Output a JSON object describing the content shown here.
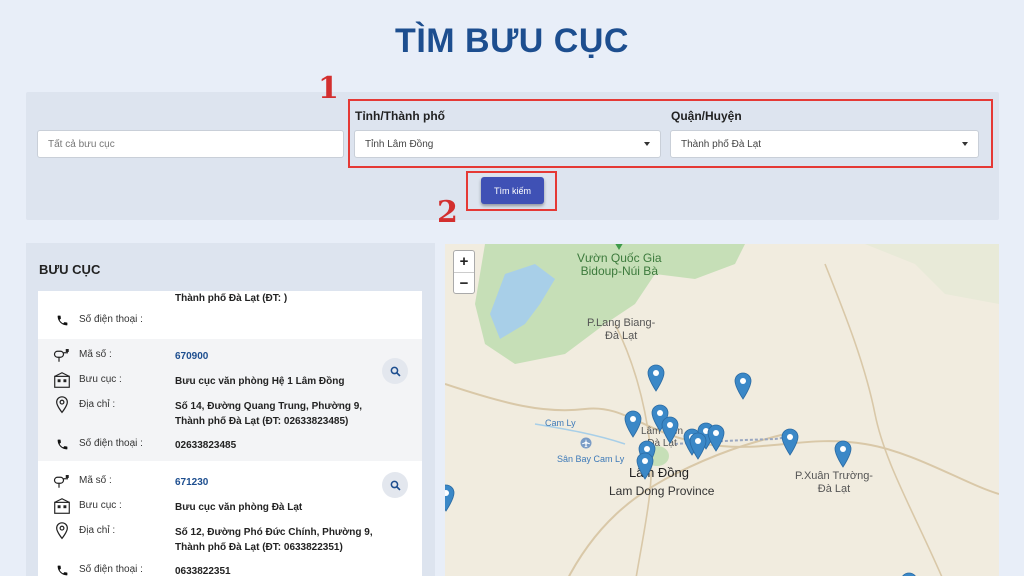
{
  "page": {
    "title": "TÌM BƯU CỤC"
  },
  "filters": {
    "search_placeholder": "Tất cả bưu cục",
    "province_label": "Tỉnh/Thành phố",
    "province_value": "Tỉnh Lâm Đồng",
    "district_label": "Quận/Huyện",
    "district_value": "Thành phố Đà Lạt",
    "search_button": "Tìm kiếm"
  },
  "annotations": {
    "step1": "1",
    "step2": "2"
  },
  "results": {
    "title": "BƯU CỤC",
    "partial": {
      "address_tail": "Thành phố Đà Lạt (ĐT: )",
      "phone_label": "Số điện thoại :",
      "phone_value": ""
    },
    "items": [
      {
        "code_label": "Mã số :",
        "code": "670900",
        "name_label": "Bưu cục :",
        "name": "Bưu cục văn phòng Hệ 1 Lâm Đồng",
        "address_label": "Địa chỉ :",
        "address": "Số 14, Đường Quang Trung, Phường 9, Thành phố Đà Lạt (ĐT: 02633823485)",
        "phone_label": "Số điện thoại :",
        "phone": "02633823485"
      },
      {
        "code_label": "Mã số :",
        "code": "671230",
        "name_label": "Bưu cục :",
        "name": "Bưu cục văn phòng Đà Lạt",
        "address_label": "Địa chỉ :",
        "address": "Số 12, Đường Phó Đức Chính, Phường 9, Thành phố Đà Lạt (ĐT: 0633822351)",
        "phone_label": "Số điện thoại :",
        "phone": "0633822351"
      }
    ]
  },
  "map": {
    "zoom_in": "+",
    "zoom_out": "−",
    "park_name": "Vườn Quốc Gia\nBidoup-Núi Bà",
    "place_langbiang": "P.Lang Biang-\nĐà Lạt",
    "place_camly": "Cam Ly",
    "place_airport": "Sân Bay Cam Ly",
    "city": "Lâm Đồng",
    "province": "Lam Dong Province",
    "place_xuantruong": "P.Xuân Trường-\nĐà Lạt",
    "place_lamvien": "Lâm Viên\nĐà Lạt"
  },
  "colors": {
    "brand": "#1d4e8f",
    "button": "#3f51b5",
    "annotation": "#e53935",
    "marker": "#3b88c7"
  }
}
